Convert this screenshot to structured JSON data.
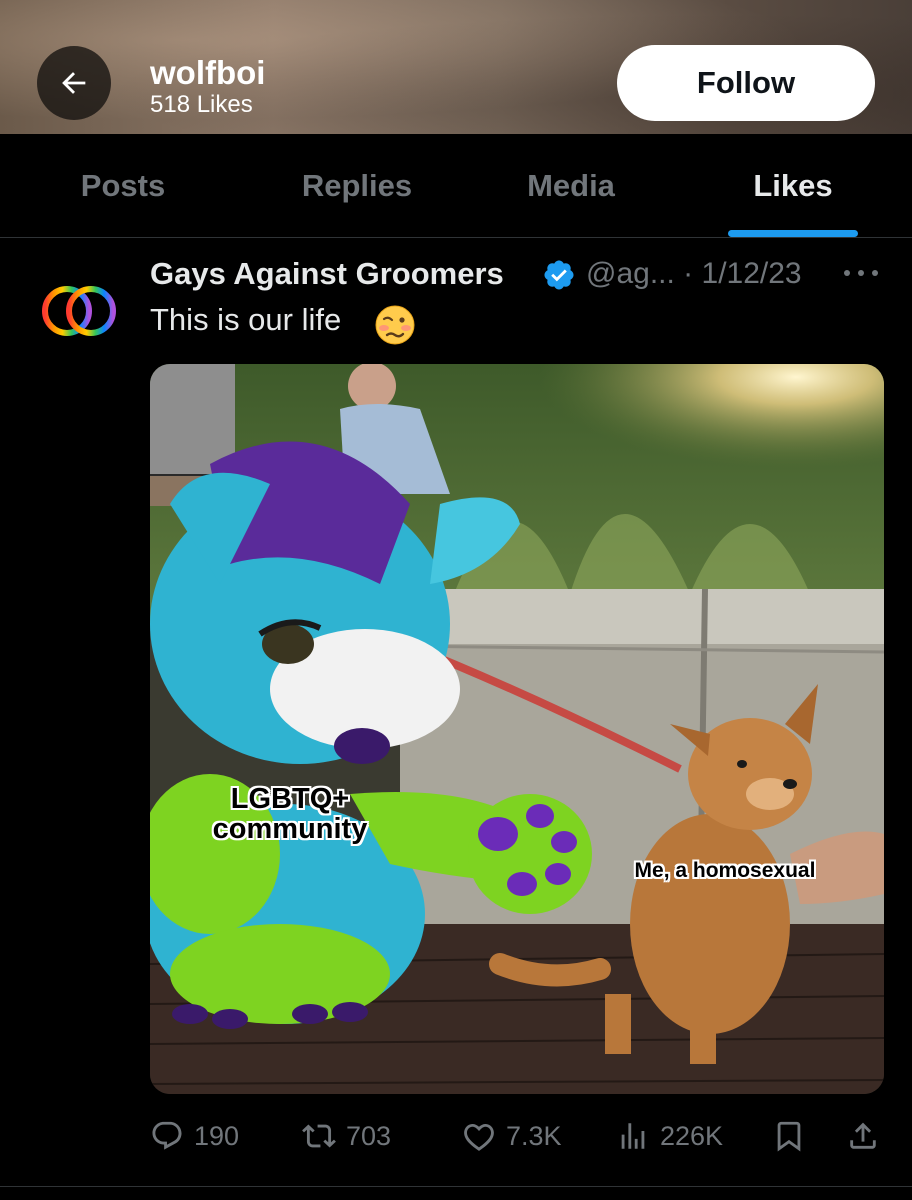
{
  "header": {
    "name": "wolfboi",
    "subtitle": "518 Likes",
    "follow_label": "Follow"
  },
  "tabs": [
    {
      "label": "Posts",
      "active": false
    },
    {
      "label": "Replies",
      "active": false
    },
    {
      "label": "Media",
      "active": false
    },
    {
      "label": "Likes",
      "active": true
    }
  ],
  "tweet": {
    "author": "Gays Against Groomers",
    "handle": "@ag...",
    "separator": "·",
    "date": "1/12/23",
    "text": "This is our life",
    "emoji": "woozy-face",
    "media": {
      "caption_left_line1": "LGBTQ+",
      "caption_left_line2": "community",
      "caption_right": "Me, a homosexual"
    },
    "actions": {
      "replies": "190",
      "reposts": "703",
      "likes": "7.3K",
      "views": "226K"
    }
  },
  "colors": {
    "accent": "#1d9bf0",
    "verified": "#1d9bf0",
    "muted": "#71767b"
  }
}
